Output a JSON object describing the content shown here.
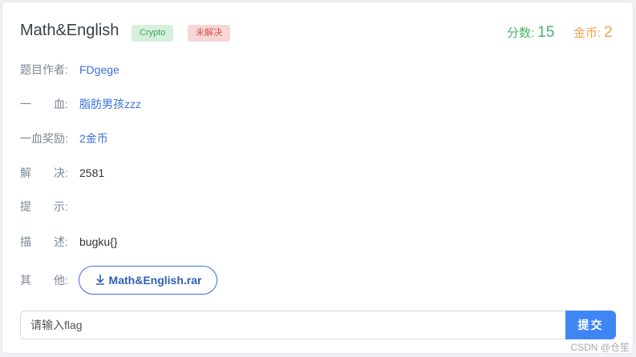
{
  "challenge": {
    "title": "Math&English",
    "category_tag": "Crypto",
    "status_tag": "未解决",
    "score_label": "分数:",
    "score_value": "15",
    "coin_label": "金币:",
    "coin_value": "2"
  },
  "details": [
    {
      "label": "题目作者:",
      "value": "FDgege"
    },
    {
      "label": "一　　血:",
      "value": "脂肪男孩zzz"
    },
    {
      "label": "一血奖励:",
      "value": "2金币"
    },
    {
      "label": "解　　决:",
      "value": "2581"
    },
    {
      "label": "提　　示:",
      "value": ""
    },
    {
      "label": "描　　述:",
      "value": "bugku{}"
    },
    {
      "label": "其　　他:",
      "value": ""
    }
  ],
  "attachment": {
    "label": "Math&English.rar",
    "icon": "download-icon"
  },
  "flag_form": {
    "placeholder": "请输入flag",
    "submit_label": "提交"
  },
  "watermark": "CSDN @仓笙",
  "colors": {
    "accent": "#3f86f5",
    "link": "#3b73d9",
    "points": "#48b46d",
    "coins": "#f0a24b",
    "category_tag_bg": "#d7f0dd",
    "status_tag_bg": "#f7d6d6"
  }
}
